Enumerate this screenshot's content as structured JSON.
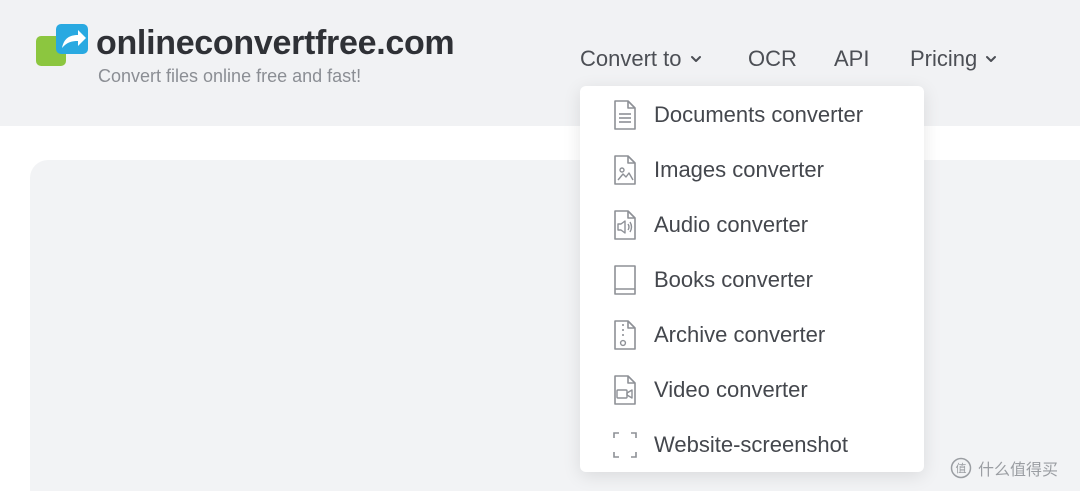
{
  "brand": {
    "name": "onlineconvertfree.com",
    "tagline": "Convert files online free and fast!",
    "colors": {
      "green": "#8cc63f",
      "blue": "#29a9e1"
    }
  },
  "nav": {
    "convert_to": "Convert to",
    "ocr": "OCR",
    "api": "API",
    "pricing": "Pricing"
  },
  "dropdown": {
    "items": [
      {
        "label": "Documents converter",
        "icon": "document-icon"
      },
      {
        "label": "Images converter",
        "icon": "image-file-icon"
      },
      {
        "label": "Audio converter",
        "icon": "audio-file-icon"
      },
      {
        "label": "Books converter",
        "icon": "book-icon"
      },
      {
        "label": "Archive converter",
        "icon": "archive-file-icon"
      },
      {
        "label": "Video converter",
        "icon": "video-file-icon"
      },
      {
        "label": "Website-screenshot",
        "icon": "screenshot-frame-icon"
      }
    ]
  },
  "watermark": {
    "text": "什么值得买"
  }
}
